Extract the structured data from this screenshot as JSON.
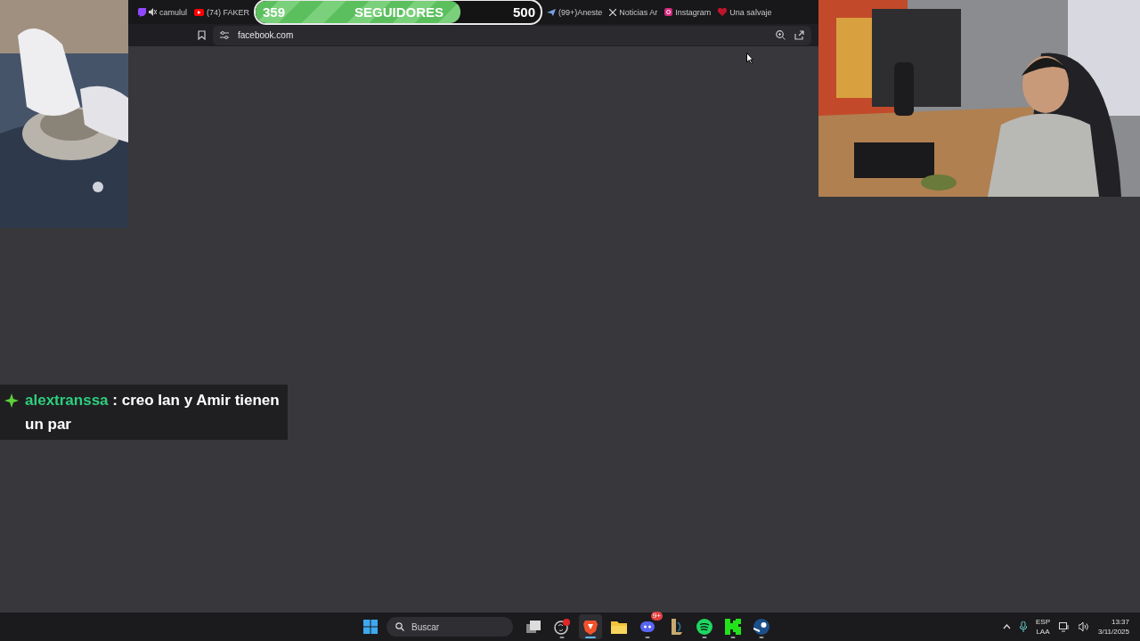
{
  "browser": {
    "tabs": [
      {
        "kind": "twitch",
        "label": "camulul",
        "muted": true
      },
      {
        "kind": "youtube",
        "label": "(74) FAKER",
        "muted": false
      },
      {
        "kind": "generic",
        "label": "(99+)Aneste",
        "muted": false
      },
      {
        "kind": "x",
        "label": "Noticias Ar",
        "muted": false
      },
      {
        "kind": "instagram",
        "label": "Instagram",
        "muted": false
      },
      {
        "kind": "game",
        "label": "Una salvaje",
        "muted": false
      }
    ],
    "address": {
      "url": "facebook.com"
    }
  },
  "follower_goal": {
    "current": "359",
    "label": "SEGUIDORES",
    "target": "500",
    "level": 0.718
  },
  "chat": {
    "user": "alextranssa",
    "separator": ":",
    "message": "creo Ian y Amir tienen un par"
  },
  "taskbar": {
    "search": {
      "placeholder": "Buscar"
    },
    "apps": [
      {
        "kind": "taskview",
        "running": false,
        "selected": false
      },
      {
        "kind": "obs",
        "running": true,
        "selected": false
      },
      {
        "kind": "brave",
        "running": true,
        "selected": true
      },
      {
        "kind": "folder",
        "running": false,
        "selected": false
      },
      {
        "kind": "discord",
        "running": true,
        "selected": false,
        "badge": "9+"
      },
      {
        "kind": "league",
        "running": false,
        "selected": false
      },
      {
        "kind": "spotify",
        "running": true,
        "selected": false
      },
      {
        "kind": "kick",
        "running": true,
        "selected": false
      },
      {
        "kind": "steam",
        "running": true,
        "selected": false
      }
    ],
    "tray": {
      "language": "ESP",
      "layout": "LAA",
      "time": "13:37",
      "date": "3/11/2025"
    }
  }
}
